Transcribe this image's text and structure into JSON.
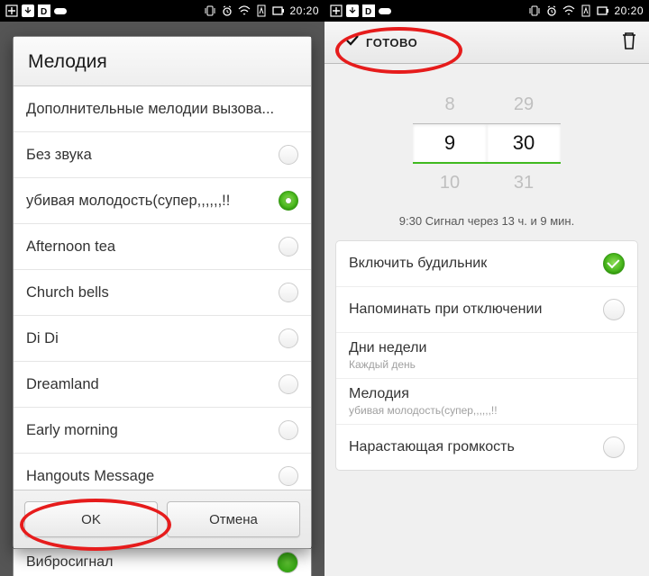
{
  "statusbar": {
    "time": "20:20"
  },
  "left": {
    "dialog_title": "Мелодия",
    "items": [
      {
        "label": "Дополнительные мелодии вызова...",
        "radio": false
      },
      {
        "label": "Без звука",
        "radio": true,
        "selected": false
      },
      {
        "label": "убивая молодость(супер,,,,,,!!",
        "radio": true,
        "selected": true
      },
      {
        "label": "Afternoon tea",
        "radio": true,
        "selected": false
      },
      {
        "label": "Church bells",
        "radio": true,
        "selected": false
      },
      {
        "label": "Di Di",
        "radio": true,
        "selected": false
      },
      {
        "label": "Dreamland",
        "radio": true,
        "selected": false
      },
      {
        "label": "Early morning",
        "radio": true,
        "selected": false
      },
      {
        "label": "Hangouts Message",
        "radio": true,
        "selected": false
      }
    ],
    "ok": "OK",
    "cancel": "Отмена",
    "peek_label": "Вибросигнал"
  },
  "right": {
    "done": "ГОТОВО",
    "picker": {
      "h_prev": "8",
      "h_cur": "9",
      "h_next": "10",
      "m_prev": "29",
      "m_cur": "30",
      "m_next": "31"
    },
    "summary": "9:30 Сигнал через 13 ч. и 9 мин.",
    "settings": [
      {
        "main": "Включить будильник",
        "type": "check",
        "on": true
      },
      {
        "main": "Напоминать при отключении",
        "type": "check",
        "on": false
      },
      {
        "main": "Дни недели",
        "sub": "Каждый день",
        "type": "nav"
      },
      {
        "main": "Мелодия",
        "sub": "убивая молодость(супер,,,,,,!!",
        "type": "nav"
      },
      {
        "main": "Нарастающая громкость",
        "type": "check",
        "on": false
      }
    ]
  }
}
